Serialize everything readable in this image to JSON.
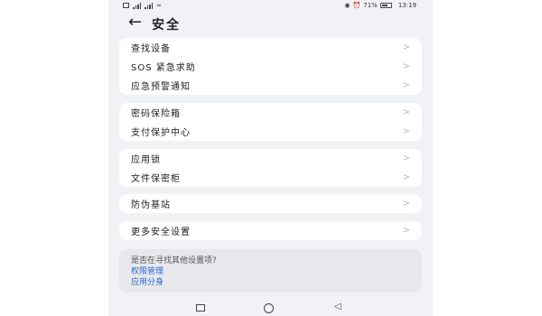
{
  "statusbar": {
    "left_icons": [
      "sim-icon",
      "signal-icon",
      "signal-icon",
      "wifi-icon"
    ],
    "battery_percent": "71%",
    "battery_level": 0.71,
    "time": "13:19"
  },
  "header": {
    "back_icon": "arrow-left-icon",
    "title": "安全"
  },
  "groups": [
    {
      "items": [
        "查找设备",
        "SOS 紧急求助",
        "应急预警通知"
      ]
    },
    {
      "items": [
        "密码保险箱",
        "支付保护中心"
      ]
    },
    {
      "items": [
        "应用锁",
        "文件保密柜"
      ]
    },
    {
      "items": [
        "防伪基站"
      ]
    },
    {
      "items": [
        "更多安全设置"
      ]
    }
  ],
  "chevron": ">",
  "hint": {
    "question": "是否在寻找其他设置项?",
    "links": [
      "权限管理",
      "应用分身"
    ]
  },
  "navbar": {
    "icons": [
      "recent-apps-icon",
      "home-icon",
      "back-icon"
    ]
  }
}
